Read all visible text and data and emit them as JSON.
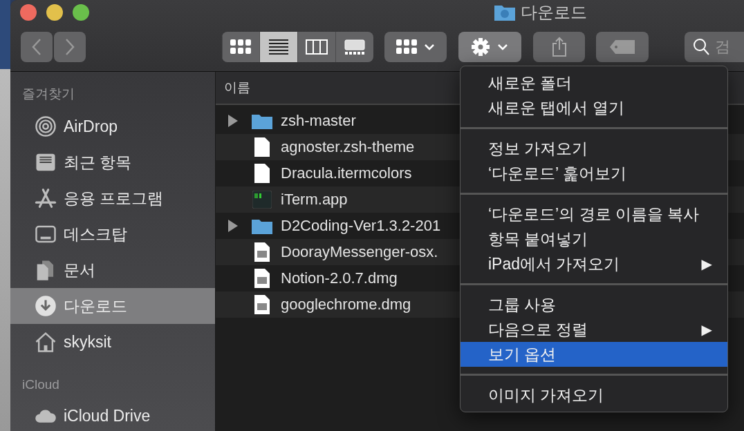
{
  "window": {
    "title": "다운로드"
  },
  "toolbar": {
    "view_modes": [
      {
        "kind": "icons",
        "selected": false
      },
      {
        "kind": "list",
        "selected": true
      },
      {
        "kind": "columns",
        "selected": false
      },
      {
        "kind": "gallery",
        "selected": false
      }
    ],
    "action_menu_open": true,
    "search": {
      "placeholder": "검"
    }
  },
  "sidebar": {
    "sections": [
      {
        "title": "즐겨찾기",
        "items": [
          {
            "label": "AirDrop",
            "kind": "airdrop",
            "selected": false
          },
          {
            "label": "최근 항목",
            "kind": "recents",
            "selected": false
          },
          {
            "label": "응용 프로그램",
            "kind": "apps",
            "selected": false
          },
          {
            "label": "데스크탑",
            "kind": "desktop",
            "selected": false
          },
          {
            "label": "문서",
            "kind": "documents",
            "selected": false
          },
          {
            "label": "다운로드",
            "kind": "downloads",
            "selected": true
          },
          {
            "label": "skyksit",
            "kind": "home",
            "selected": false
          }
        ]
      },
      {
        "title": "iCloud",
        "items": [
          {
            "label": "iCloud Drive",
            "kind": "cloud",
            "selected": false
          }
        ]
      }
    ]
  },
  "file_list": {
    "columns": [
      "이름"
    ],
    "rows": [
      {
        "name": "zsh-master",
        "kind": "folder",
        "expandable": true
      },
      {
        "name": "agnoster.zsh-theme",
        "kind": "document",
        "expandable": false
      },
      {
        "name": "Dracula.itermcolors",
        "kind": "document",
        "expandable": false
      },
      {
        "name": "iTerm.app",
        "kind": "app",
        "expandable": false
      },
      {
        "name": "D2Coding-Ver1.3.2-201",
        "kind": "folder",
        "expandable": true
      },
      {
        "name": "DoorayMessenger-osx.",
        "kind": "disk-image",
        "expandable": false
      },
      {
        "name": "Notion-2.0.7.dmg",
        "kind": "disk-image",
        "expandable": false
      },
      {
        "name": "googlechrome.dmg",
        "kind": "disk-image",
        "expandable": false
      }
    ]
  },
  "action_menu": {
    "groups": [
      [
        {
          "label": "새로운 폴더",
          "kind": "action",
          "selected": false
        },
        {
          "label": "새로운 탭에서 열기",
          "kind": "action",
          "selected": false
        }
      ],
      [
        {
          "label": "정보 가져오기",
          "kind": "action",
          "selected": false
        },
        {
          "label": "‘다운로드’ 훑어보기",
          "kind": "action",
          "selected": false
        }
      ],
      [
        {
          "label": "‘다운로드’의 경로 이름을 복사",
          "kind": "action",
          "selected": false
        },
        {
          "label": "항목 붙여넣기",
          "kind": "action",
          "selected": false
        },
        {
          "label": "iPad에서 가져오기",
          "kind": "submenu",
          "arrow": "▶",
          "selected": false
        }
      ],
      [
        {
          "label": "그룹 사용",
          "kind": "action",
          "selected": false
        },
        {
          "label": "다음으로 정렬",
          "kind": "submenu",
          "arrow": "▶",
          "selected": false
        },
        {
          "label": "보기 옵션",
          "kind": "action",
          "selected": true
        }
      ],
      [
        {
          "label": "이미지 가져오기",
          "kind": "action",
          "selected": false
        }
      ]
    ]
  }
}
